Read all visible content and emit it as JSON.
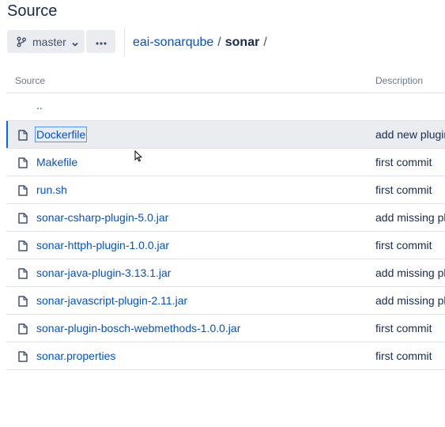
{
  "page": {
    "title": "Source"
  },
  "toolbar": {
    "branch_label": "master",
    "more_label": "..."
  },
  "breadcrumb": {
    "repo": "eai-sonarqube",
    "separator": "/",
    "current": "sonar",
    "trailing_separator": "/"
  },
  "table": {
    "headers": {
      "source": "Source",
      "description": "Description"
    },
    "parent_row": "..",
    "rows": [
      {
        "name": "Dockerfile",
        "description": "add new plugin",
        "selected": true
      },
      {
        "name": "Makefile",
        "description": "first commit"
      },
      {
        "name": "run.sh",
        "description": "first commit"
      },
      {
        "name": "sonar-csharp-plugin-5.0.jar",
        "description": "add missing pl"
      },
      {
        "name": "sonar-httph-plugin-1.0.0.jar",
        "description": "first commit"
      },
      {
        "name": "sonar-java-plugin-3.13.1.jar",
        "description": "add missing pl"
      },
      {
        "name": "sonar-javascript-plugin-2.11.jar",
        "description": "add missing pl"
      },
      {
        "name": "sonar-plugin-bosch-webmethods-1.0.0.jar",
        "description": "first commit"
      },
      {
        "name": "sonar.properties",
        "description": "first commit"
      }
    ]
  },
  "icons": {
    "branch": "branch-icon",
    "chevron": "chevron-down-icon",
    "more": "more-icon",
    "file": "file-icon",
    "cursor": "mouse-cursor-icon"
  },
  "colors": {
    "link": "#0052cc",
    "text": "#172b4d",
    "muted": "#6b778c",
    "button_bg": "#ebecf0",
    "selected_bg": "#ebecf0",
    "selected_accent": "#0065ff",
    "border": "#dfe1e6"
  }
}
